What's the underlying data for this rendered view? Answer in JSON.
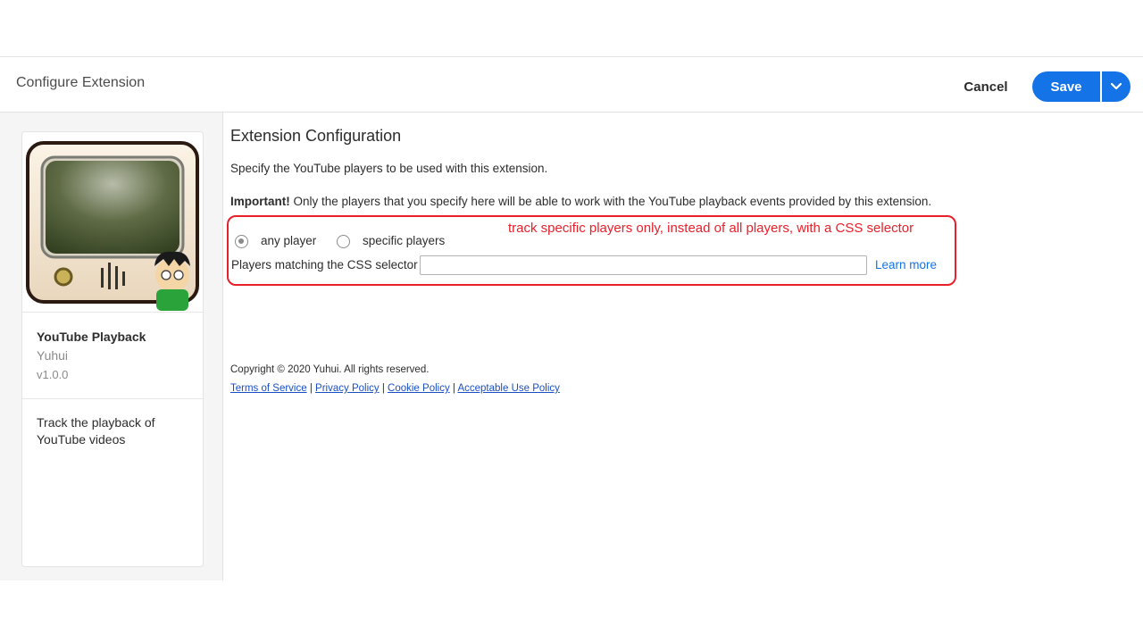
{
  "header": {
    "title": "Configure Extension",
    "cancel_label": "Cancel",
    "save_label": "Save"
  },
  "extension": {
    "name": "YouTube Playback",
    "author": "Yuhui",
    "version": "v1.0.0",
    "description": "Track the playback of YouTube videos"
  },
  "config": {
    "title": "Extension Configuration",
    "intro": "Specify the YouTube players to be used with this extension.",
    "important_label": "Important!",
    "important_text": " Only the players that you specify here will be able to work with the YouTube playback events provided by this extension.",
    "annotation": "track specific players only, instead of all players, with a CSS selector",
    "radio_any": "any player",
    "radio_specific": "specific players",
    "selected": "any player",
    "selector_label": "Players matching the CSS selector",
    "selector_value": "",
    "learn_more": "Learn more"
  },
  "footer": {
    "copyright": "Copyright © 2020 Yuhui. All rights reserved.",
    "links": [
      "Terms of Service",
      "Privacy Policy",
      "Cookie Policy",
      "Acceptable Use Policy"
    ],
    "separator": "|"
  },
  "colors": {
    "accent": "#1473e6",
    "annotation": "#e8202a"
  }
}
